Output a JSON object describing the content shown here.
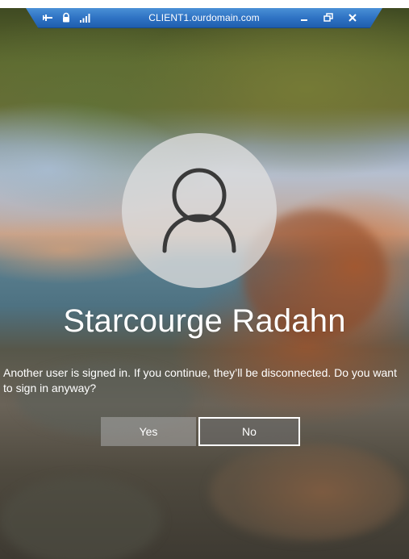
{
  "rdp_bar": {
    "title": "CLIENT1.ourdomain.com",
    "left_icons": [
      "pin-icon",
      "lock-icon",
      "signal-bars-icon"
    ],
    "right_icons": [
      "minimize-icon",
      "restore-icon",
      "close-icon"
    ],
    "color": "#2f73c4"
  },
  "lock_screen": {
    "user_icon": "user-avatar-icon",
    "user_name": "Starcourge Radahn",
    "message": "Another user is signed in. If you continue, they’ll be disconnected. Do you want to sign in anyway?",
    "yes_label": "Yes",
    "no_label": "No"
  }
}
